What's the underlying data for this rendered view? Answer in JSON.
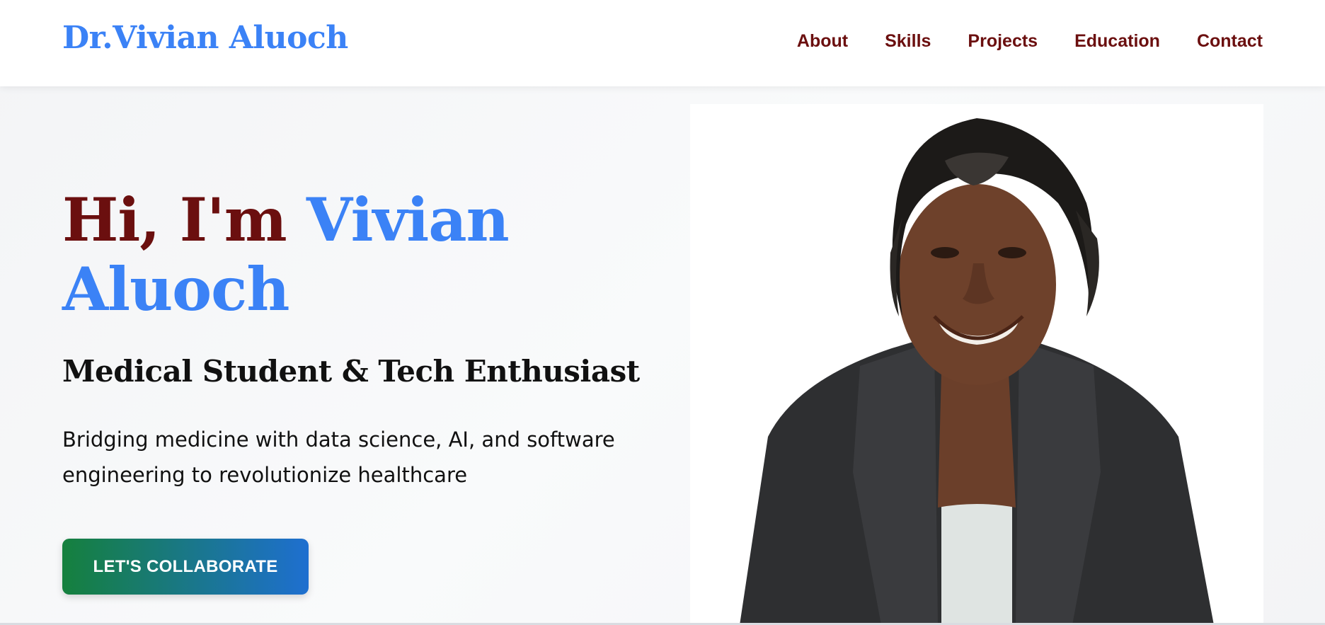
{
  "header": {
    "brand": "Dr.Vivian Aluoch",
    "nav": [
      {
        "label": "About"
      },
      {
        "label": "Skills"
      },
      {
        "label": "Projects"
      },
      {
        "label": "Education"
      },
      {
        "label": "Contact"
      }
    ]
  },
  "hero": {
    "greeting": "Hi, I'm",
    "name": "Vivian Aluoch",
    "subtitle": "Medical Student & Tech Enthusiast",
    "description": "Bridging medicine with data science, AI, and software engineering to revolutionize healthcare",
    "cta_label": "LET'S COLLABORATE"
  },
  "colors": {
    "accent_blue": "#3b82f6",
    "maroon": "#6b0f0f",
    "cta_gradient_start": "#15803d",
    "cta_gradient_end": "#1e6fd0"
  },
  "icons": {
    "portrait": "profile-photo"
  }
}
